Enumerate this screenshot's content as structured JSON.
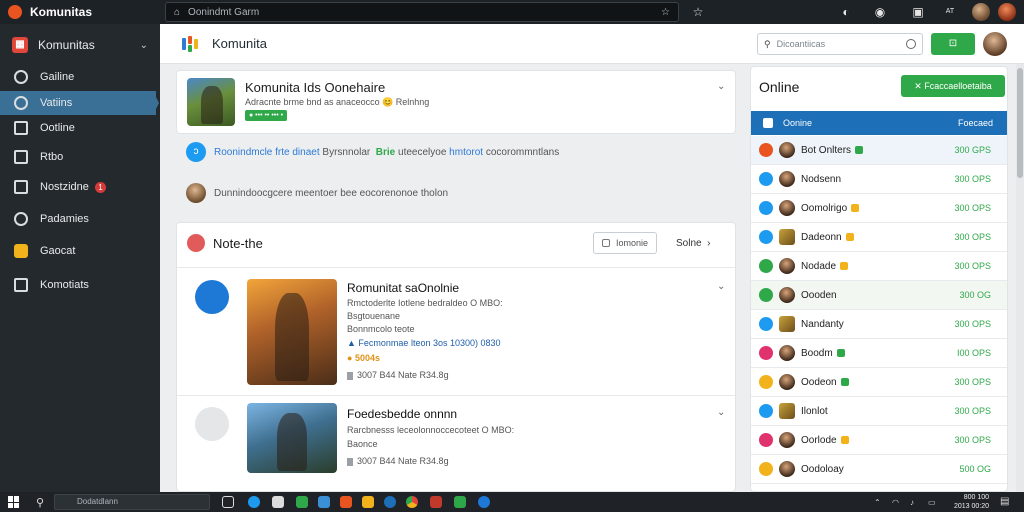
{
  "topbar": {
    "app_name": "Komunitas",
    "url": "Oonindmt Garm",
    "tray_label": "AT"
  },
  "sidebar": {
    "header_title": "Komunitas",
    "items": [
      {
        "label": "Gailine"
      },
      {
        "label": "Vatiins"
      },
      {
        "label": "Ootline"
      },
      {
        "label": "Rtbo"
      },
      {
        "label": "Nostzidne",
        "badge": "1"
      },
      {
        "label": "Padamies"
      },
      {
        "label": "Gaocat"
      },
      {
        "label": "Komotiats"
      }
    ]
  },
  "header": {
    "title": "Komunita",
    "search_placeholder": "Dicoantiicas",
    "green_button": "⊡"
  },
  "feature_card": {
    "title": "Komunita Ids Oonehaire",
    "subtitle": "Adracnte brme bnd as anaceocco 😊 Relnhng",
    "pill": "● ••• •• ••• •"
  },
  "info_rows": [
    {
      "prefix": "Roonindmcle frte",
      "blue": "dinaet",
      "mid": "Byrsnnolar",
      "green": "Brie",
      "rest": "uteecelyoe",
      "blue2": "hmtorot",
      "tail": "cocorommntlans"
    },
    {
      "text": "Dunnindoocgcere meentoer bee eocorenonoe tholon"
    }
  ],
  "notes": {
    "title": "Note-the",
    "button_label": "Iomonie",
    "link_label": "Solne"
  },
  "posts": [
    {
      "title": "Romunitat saOnolnie",
      "lines": [
        "Rmctoderlte Iotlene bedraldeo O MBO:",
        "Bsgtouenane",
        "Bonnmcolo teote"
      ],
      "blue_line": "Fecmonmae lteon 3os 10300) 0830",
      "orange_line": "5004s",
      "meta": "3007 B44 Nate  R34.8g"
    },
    {
      "title": "Foedesbedde onnnn",
      "lines": [
        "Rarcbnesss leceolonnoccecoteet O MBO:",
        "Baonce"
      ],
      "meta": "3007 B44 Nate  R34.8g"
    }
  ],
  "online": {
    "title": "Online",
    "button": "Fcaccaelloetaiba",
    "header_left": "Oonine",
    "header_right": "Foecaed",
    "rows": [
      {
        "name": "Bot Onlters",
        "value": "300 GPS",
        "dot": "#e95420",
        "tag": "#2fa84a"
      },
      {
        "name": "Nodsenn",
        "value": "300 OPS",
        "dot": "#1d9bf0",
        "tag": ""
      },
      {
        "name": "Oomolrigo",
        "value": "300 OPS",
        "dot": "#1d9bf0",
        "tag": "#f2b21b"
      },
      {
        "name": "Dadeonn",
        "value": "300 OPS",
        "dot": "#1d9bf0",
        "tag": "#f2b21b"
      },
      {
        "name": "Nodade",
        "value": "300 OPS",
        "dot": "#2fa84a",
        "tag": "#f2b21b"
      },
      {
        "name": "Oooden",
        "value": "300 OG",
        "dot": "#2fa84a",
        "tag": ""
      },
      {
        "name": "Nandanty",
        "value": "300 OPS",
        "dot": "#1d9bf0",
        "tag": ""
      },
      {
        "name": "Boodm",
        "value": "I00 OPS",
        "dot": "#e0336e",
        "tag": "#2fa84a"
      },
      {
        "name": "Oodeon",
        "value": "300 OPS",
        "dot": "#f2b21b",
        "tag": "#2fa84a"
      },
      {
        "name": "Ilonlot",
        "value": "300 OPS",
        "dot": "#1d9bf0",
        "tag": ""
      },
      {
        "name": "Oorlode",
        "value": "300 OPS",
        "dot": "#e0336e",
        "tag": "#f2b21b"
      },
      {
        "name": "Oodoloay",
        "value": "500 OG",
        "dot": "#f2b21b",
        "tag": ""
      }
    ]
  },
  "taskbar": {
    "search_placeholder": "Dodatdlann",
    "time": "800 100",
    "date": "2013 00:20"
  },
  "colors": {
    "accent_blue": "#1d6fb8",
    "accent_green": "#2fa84a",
    "sidebar_bg": "#24292e"
  }
}
